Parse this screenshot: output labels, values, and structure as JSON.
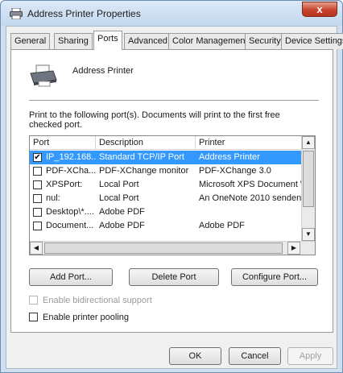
{
  "window": {
    "title": "Address Printer Properties",
    "close_label": "x"
  },
  "tabs": [
    {
      "label": "General"
    },
    {
      "label": "Sharing"
    },
    {
      "label": "Ports"
    },
    {
      "label": "Advanced"
    },
    {
      "label": "Color Management"
    },
    {
      "label": "Security"
    },
    {
      "label": "Device Settings"
    }
  ],
  "active_tab": "Ports",
  "panel": {
    "printer_name": "Address Printer",
    "description": "Print to the following port(s). Documents will print to the first free checked port."
  },
  "ports_table": {
    "columns": [
      "Port",
      "Description",
      "Printer"
    ],
    "rows": [
      {
        "checked": true,
        "selected": true,
        "port": "IP_192.168....",
        "description": "Standard TCP/IP Port",
        "printer": "Address Printer"
      },
      {
        "checked": false,
        "selected": false,
        "port": "PDF-XCha...",
        "description": "PDF-XChange monitor",
        "printer": "PDF-XChange 3.0"
      },
      {
        "checked": false,
        "selected": false,
        "port": "XPSPort:",
        "description": "Local Port",
        "printer": "Microsoft XPS Document Writ"
      },
      {
        "checked": false,
        "selected": false,
        "port": "nul:",
        "description": "Local Port",
        "printer": "An OneNote 2010 senden"
      },
      {
        "checked": false,
        "selected": false,
        "port": "Desktop\\*....",
        "description": "Adobe PDF",
        "printer": ""
      },
      {
        "checked": false,
        "selected": false,
        "port": "Document...",
        "description": "Adobe PDF",
        "printer": "Adobe PDF"
      }
    ]
  },
  "port_buttons": {
    "add": "Add Port...",
    "delete": "Delete Port",
    "configure": "Configure Port..."
  },
  "options": {
    "bidirectional": {
      "label": "Enable bidirectional support",
      "checked": false,
      "enabled": false
    },
    "pooling": {
      "label": "Enable printer pooling",
      "checked": false,
      "enabled": true
    }
  },
  "dialog_buttons": {
    "ok": "OK",
    "cancel": "Cancel",
    "apply": "Apply"
  },
  "colors": {
    "selection": "#3399ff",
    "titlebar": "#cfdff0",
    "close": "#c7432b"
  },
  "icons": {
    "title": "printer-icon",
    "panel": "printer-icon"
  }
}
